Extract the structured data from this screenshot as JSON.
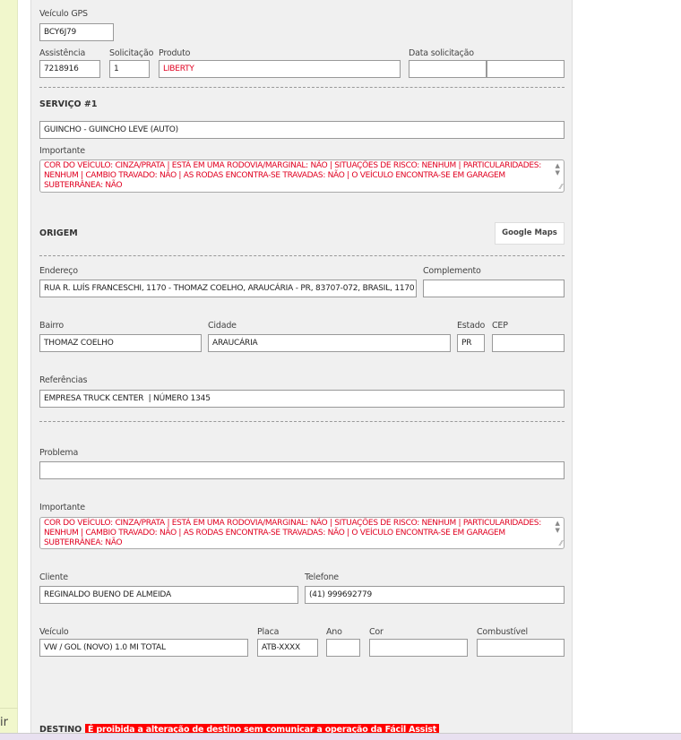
{
  "sidebar": {
    "partial_label": "air"
  },
  "veiculo_gps": {
    "label": "Veículo GPS",
    "value": "BCY6J79"
  },
  "assistencia": {
    "label": "Assistência",
    "value": "7218916"
  },
  "solicitacao": {
    "label": "Solicitação",
    "value": "1"
  },
  "produto": {
    "label": "Produto",
    "value": "LIBERTY"
  },
  "data_solicitacao": {
    "label": "Data solicitação",
    "date": "",
    "time": ""
  },
  "servico": {
    "title": "SERVIÇO #1",
    "value": "GUINCHO - GUINCHO LEVE (AUTO)",
    "importante_label": "Importante",
    "importante": "COR DO VEÍCULO: CINZA/PRATA | ESTÁ EM UMA RODOVIA/MARGINAL: NÃO | SITUAÇÕES DE RISCO: NENHUM | PARTICULARIDADES: NENHUM | CAMBIO TRAVADO: NÃO | AS RODAS ENCONTRA-SE TRAVADAS: NÃO | O VEÍCULO ENCONTRA-SE EM GARAGEM SUBTERRÂNEA: NÃO"
  },
  "origem": {
    "title": "ORIGEM",
    "maps_button": "Google Maps",
    "endereco": {
      "label": "Endereço",
      "value": "RUA R. LUÍS FRANCESCHI, 1170 - THOMAZ COELHO, ARAUCÁRIA - PR, 83707-072, BRASIL, 1170"
    },
    "complemento": {
      "label": "Complemento",
      "value": ""
    },
    "bairro": {
      "label": "Bairro",
      "value": "THOMAZ COELHO"
    },
    "cidade": {
      "label": "Cidade",
      "value": "ARAUCÁRIA"
    },
    "estado": {
      "label": "Estado",
      "value": "PR"
    },
    "cep": {
      "label": "CEP",
      "value": ""
    },
    "referencias": {
      "label": "Referências",
      "value": "EMPRESA TRUCK CENTER  | NÚMERO 1345"
    }
  },
  "problema": {
    "label": "Problema",
    "value": "",
    "importante_label": "Importante",
    "importante": "COR DO VEÍCULO: CINZA/PRATA | ESTÁ EM UMA RODOVIA/MARGINAL: NÃO | SITUAÇÕES DE RISCO: NENHUM | PARTICULARIDADES: NENHUM | CAMBIO TRAVADO: NÃO | AS RODAS ENCONTRA-SE TRAVADAS: NÃO | O VEÍCULO ENCONTRA-SE EM GARAGEM SUBTERRÂNEA: NÃO"
  },
  "cliente": {
    "label": "Cliente",
    "value": "REGINALDO BUENO DE ALMEIDA"
  },
  "telefone": {
    "label": "Telefone",
    "value": "(41) 999692779"
  },
  "veiculo": {
    "label": "Veículo",
    "value": "VW / GOL (NOVO) 1.0 MI TOTAL"
  },
  "placa": {
    "label": "Placa",
    "value": "ATB-XXXX"
  },
  "ano": {
    "label": "Ano",
    "value": ""
  },
  "cor": {
    "label": "Cor",
    "value": ""
  },
  "combustivel": {
    "label": "Combustível",
    "value": ""
  },
  "destino": {
    "title": "DESTINO",
    "warning": "É proibida a alteração de destino sem comunicar a operação da Fácil Assist"
  },
  "colors": {
    "sidebar": "#f1f7cc",
    "panel": "#f0f0f0",
    "alert": "#ff0000",
    "text_red": "#e00020"
  }
}
